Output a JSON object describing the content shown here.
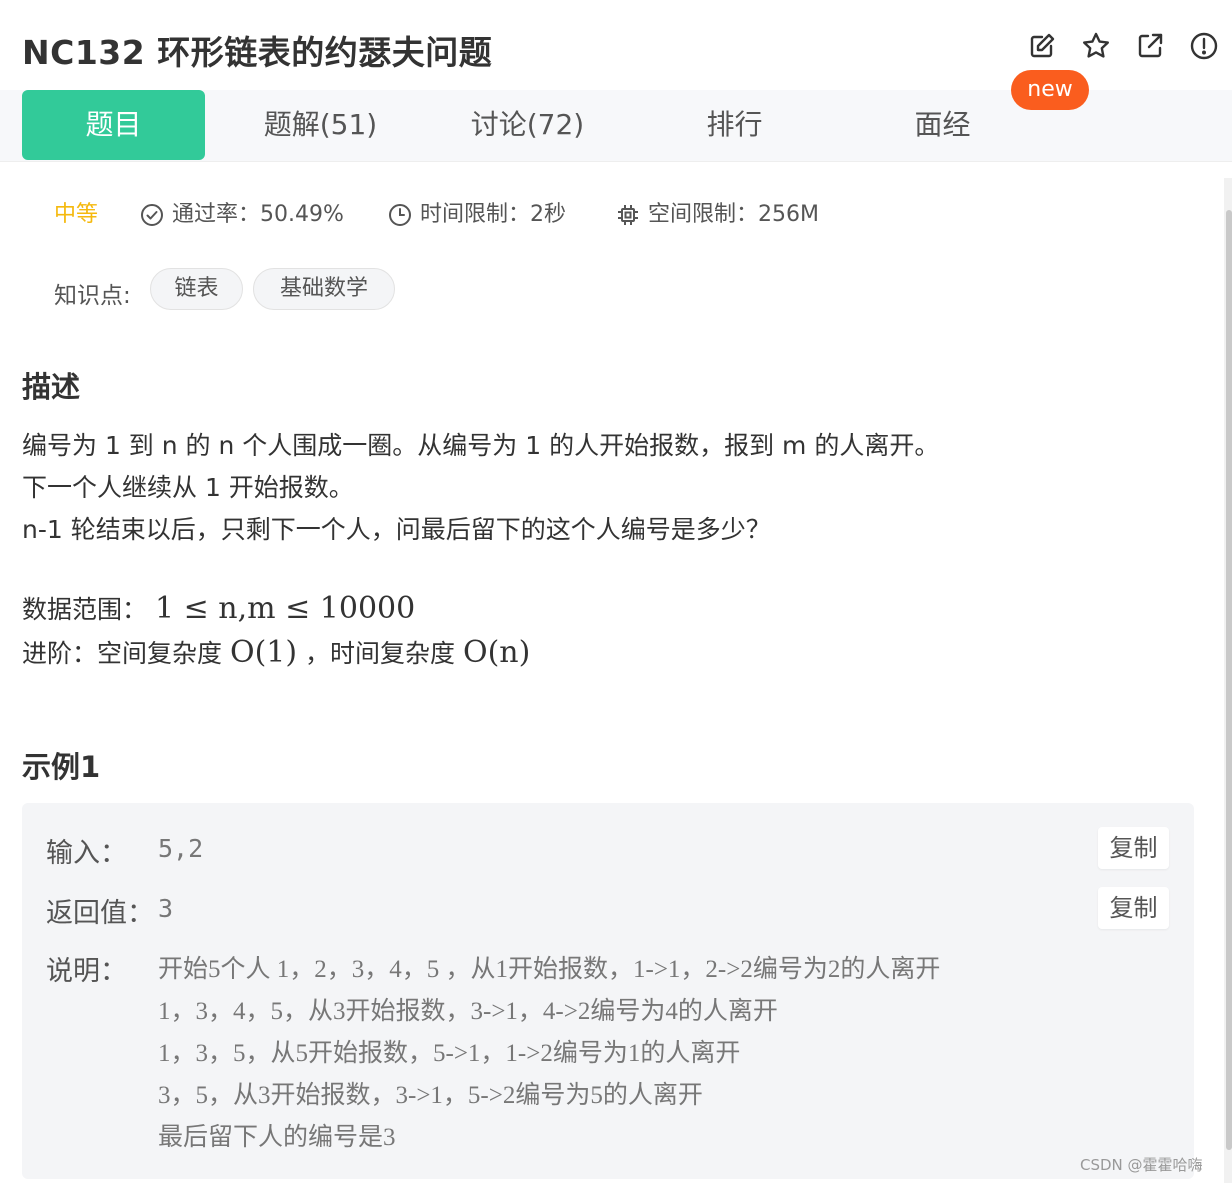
{
  "header": {
    "title": "NC132  环形链表的约瑟夫问题",
    "actions": [
      "edit-icon",
      "star-icon",
      "external-link-icon",
      "alert-icon"
    ]
  },
  "tabs": [
    {
      "label": "题目",
      "active": true
    },
    {
      "label": "题解(51)"
    },
    {
      "label": "讨论(72)"
    },
    {
      "label": "排行"
    },
    {
      "label": "面经"
    }
  ],
  "badge_new": "new",
  "meta": {
    "difficulty": "中等",
    "pass_rate": "通过率：50.49%",
    "time_limit": "时间限制：2秒",
    "space_limit": "空间限制：256M"
  },
  "knowledge": {
    "label": "知识点:",
    "tags": [
      "链表",
      "基础数学"
    ]
  },
  "description": {
    "heading": "描述",
    "lines": [
      "编号为 1 到 n 的 n 个人围成一圈。从编号为 1 的人开始报数，报到 m 的人离开。",
      "下一个人继续从 1 开始报数。",
      "n-1 轮结束以后，只剩下一个人，问最后留下的这个人编号是多少？"
    ],
    "range_label": "数据范围：",
    "range_math": "1 ≤ n,m ≤ 10000",
    "advanced_label": "进阶：空间复杂度",
    "space_complexity": "O(1)",
    "advanced_middle": "，时间复杂度",
    "time_complexity": "O(n)"
  },
  "example": {
    "heading": "示例1",
    "input_label": "输入：",
    "input_value": "5,2",
    "return_label": "返回值：",
    "return_value": "3",
    "explain_label": "说明：",
    "explain_lines": [
      "开始5个人 1，2，3，4，5 ，从1开始报数，1->1，2->2编号为2的人离开",
      "1，3，4，5，从3开始报数，3->1，4->2编号为4的人离开",
      "1，3，5，从5开始报数，5->1，1->2编号为1的人离开",
      "3，5，从3开始报数，3->1，5->2编号为5的人离开",
      "最后留下人的编号是3"
    ],
    "copy_label": "复制"
  },
  "watermark": "CSDN @霍霍哈嗨",
  "colors": {
    "accent": "#32ca99",
    "badge": "#fa5d1e",
    "difficulty": "#f5b90e"
  }
}
